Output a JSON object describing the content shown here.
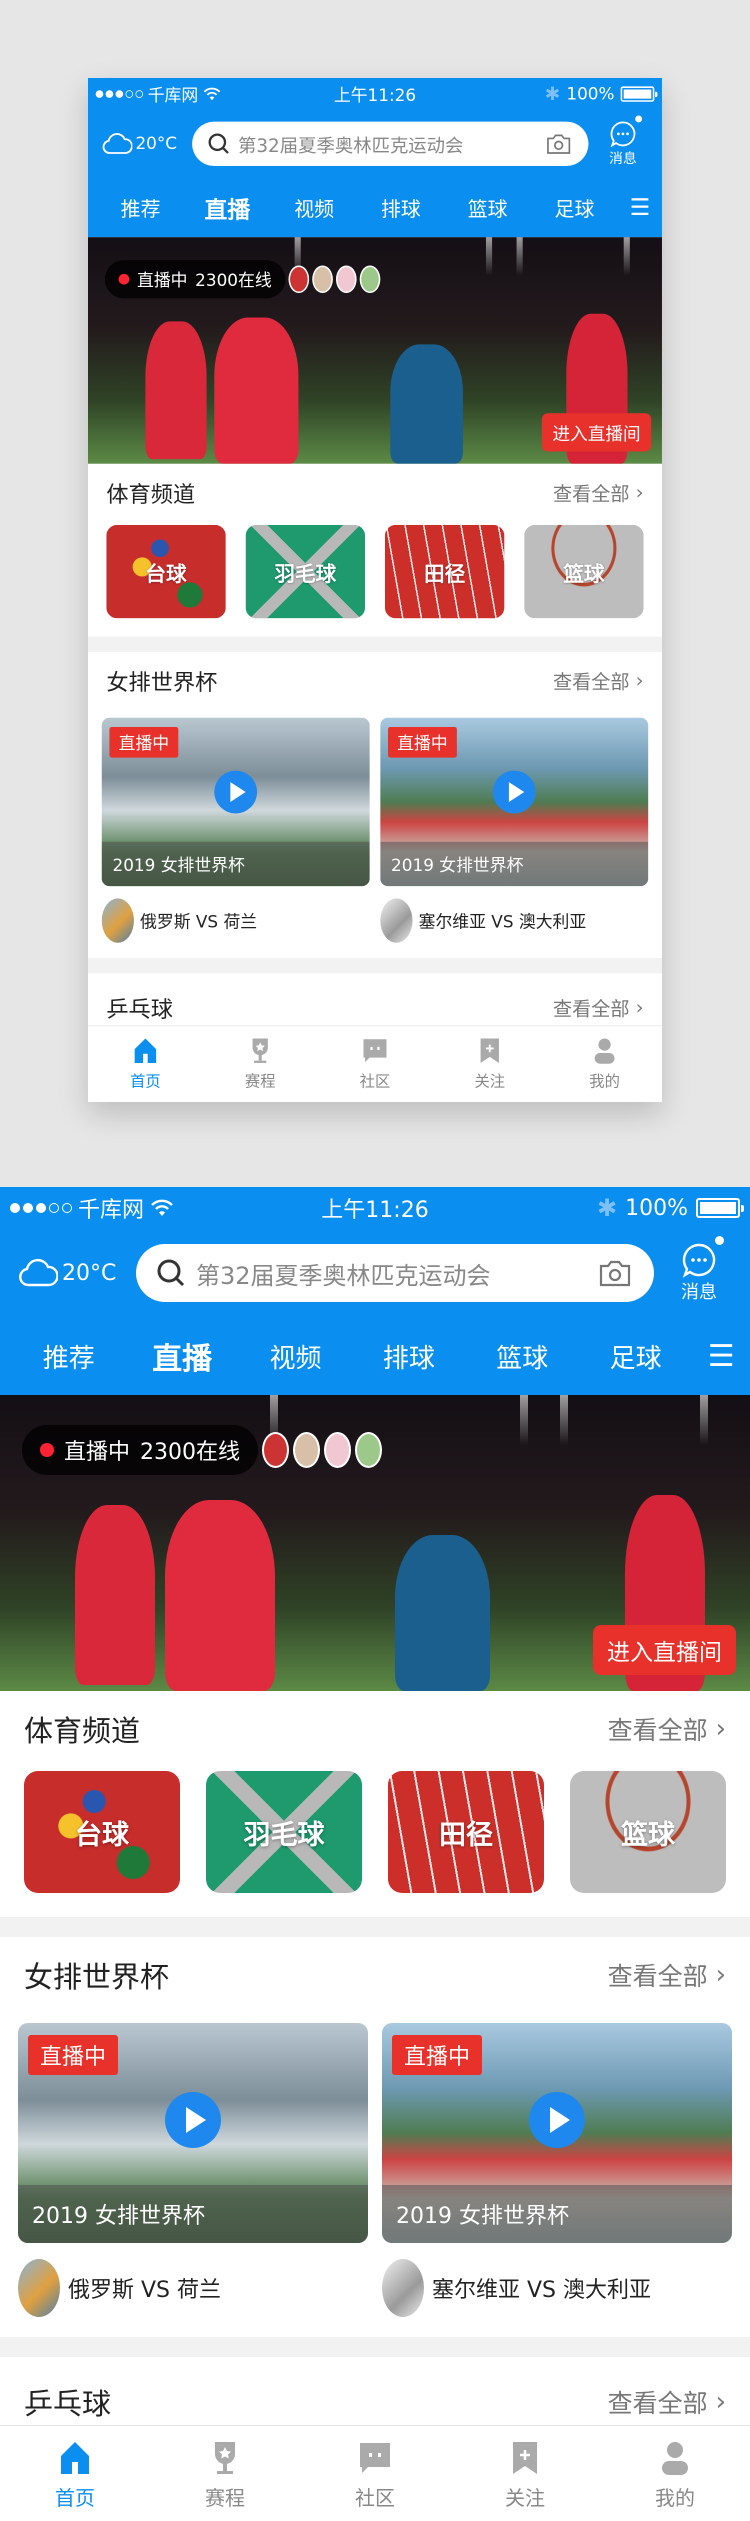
{
  "status_bar": {
    "carrier": "千库网",
    "time": "上午11:26",
    "battery": "100%",
    "signal_filled": 3,
    "signal_total": 5,
    "battery_level": 1.0
  },
  "search_bar": {
    "weather_temp": "20°C",
    "placeholder": "第32届夏季奥林匹克运动会",
    "message_label": "消息"
  },
  "nav_tabs": [
    {
      "label": "推荐",
      "active": false
    },
    {
      "label": "直播",
      "active": true
    },
    {
      "label": "视频",
      "active": false
    },
    {
      "label": "排球",
      "active": false
    },
    {
      "label": "篮球",
      "active": false
    },
    {
      "label": "足球",
      "active": false
    }
  ],
  "menu_icon": "☰",
  "hero": {
    "live_label": "直播中",
    "online_count": "2300在线",
    "enter_button": "进入直播间"
  },
  "sports_channels": {
    "title": "体育频道",
    "more": "查看全部",
    "items": [
      {
        "label": "台球",
        "color": "#c62d2b"
      },
      {
        "label": "羽毛球",
        "color": "#1e9a6e"
      },
      {
        "label": "田径",
        "color": "#cc2f2a"
      },
      {
        "label": "篮球",
        "color": "#b8b8b8"
      }
    ]
  },
  "volleyball": {
    "title": "女排世界杯",
    "more": "查看全部",
    "cards": [
      {
        "badge": "直播中",
        "caption": "2019 女排世界杯",
        "match": "俄罗斯 VS 荷兰"
      },
      {
        "badge": "直播中",
        "caption": "2019 女排世界杯",
        "match": "塞尔维亚 VS 澳大利亚"
      }
    ]
  },
  "pingpong": {
    "title": "乒乓球",
    "more": "查看全部"
  },
  "tab_bar": [
    {
      "label": "首页",
      "icon": "home-icon",
      "active": true
    },
    {
      "label": "赛程",
      "icon": "trophy-icon",
      "active": false
    },
    {
      "label": "社区",
      "icon": "chat-icon",
      "active": false
    },
    {
      "label": "关注",
      "icon": "bookmark-icon",
      "active": false
    },
    {
      "label": "我的",
      "icon": "user-icon",
      "active": false
    }
  ],
  "colors": {
    "brand_blue": "#0a8ef0",
    "live_red": "#e8312a",
    "inactive_gray": "#888888"
  }
}
